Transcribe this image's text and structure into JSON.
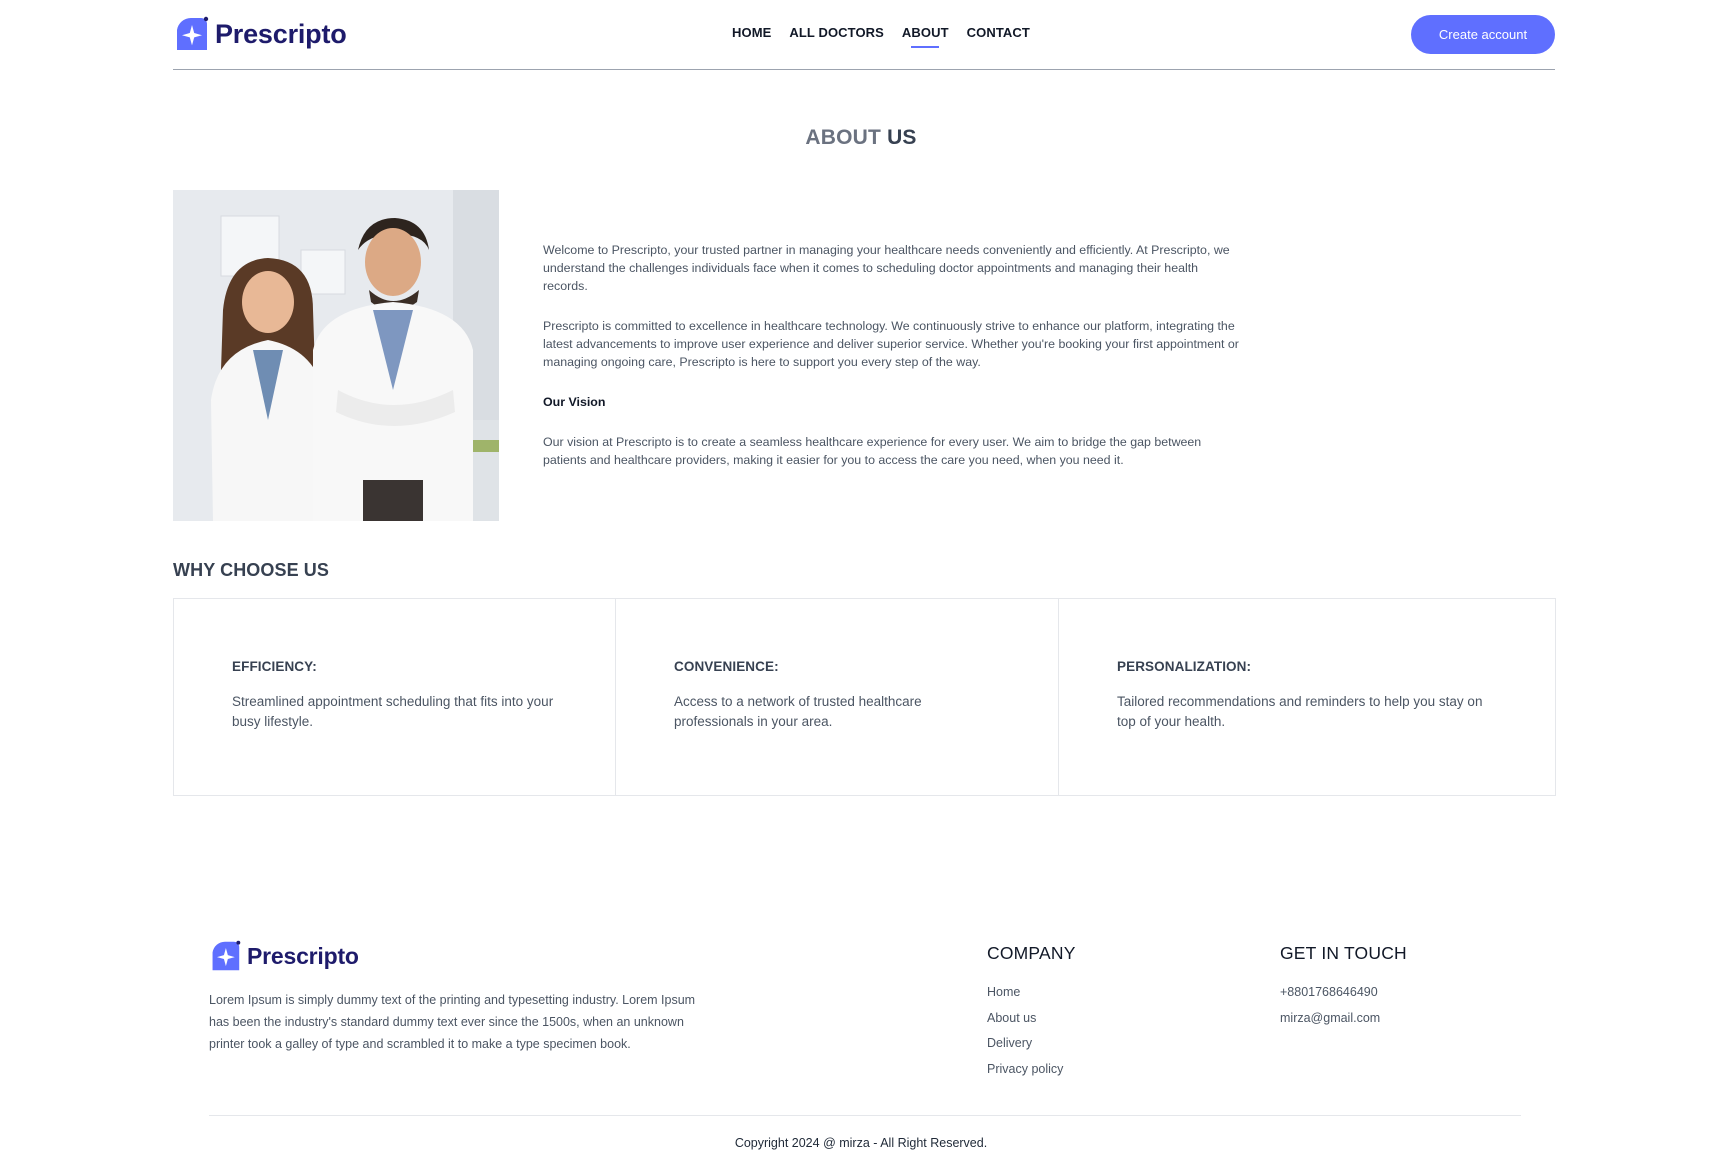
{
  "brand": {
    "name": "Prescripto",
    "accent_color": "#5f6fff",
    "brand_text_color": "#1e1b6b",
    "logo_icon": "star-cross-icon"
  },
  "nav": {
    "items": [
      {
        "label": "HOME",
        "active": false
      },
      {
        "label": "ALL DOCTORS",
        "active": false
      },
      {
        "label": "ABOUT",
        "active": true
      },
      {
        "label": "CONTACT",
        "active": false
      }
    ],
    "cta_label": "Create account"
  },
  "about": {
    "title_light": "ABOUT",
    "title_bold": "US",
    "paragraph_1": "Welcome to Prescripto, your trusted partner in managing your healthcare needs conveniently and efficiently. At Prescripto, we understand the challenges individuals face when it comes to scheduling doctor appointments and managing their health records.",
    "paragraph_2": "Prescripto is committed to excellence in healthcare technology. We continuously strive to enhance our platform, integrating the latest advancements to improve user experience and deliver superior service. Whether you're booking your first appointment or managing ongoing care, Prescripto is here to support you every step of the way.",
    "vision_title": "Our Vision",
    "vision_text": "Our vision at Prescripto is to create a seamless healthcare experience for every user. We aim to bridge the gap between patients and healthcare providers, making it easier for you to access the care you need, when you need it."
  },
  "why": {
    "title_light": "WHY",
    "title_bold": "CHOOSE US",
    "cards": [
      {
        "title": "EFFICIENCY:",
        "text": "Streamlined appointment scheduling that fits into your busy lifestyle."
      },
      {
        "title": "CONVENIENCE:",
        "text": "Access to a network of trusted healthcare professionals in your area."
      },
      {
        "title": "PERSONALIZATION:",
        "text": "Tailored recommendations and reminders to help you stay on top of your health."
      }
    ]
  },
  "footer": {
    "brand_name": "Prescripto",
    "description": "Lorem Ipsum is simply dummy text of the printing and typesetting industry. Lorem Ipsum has been the industry's standard dummy text ever since the 1500s, when an unknown printer took a galley of type and scrambled it to make a type specimen book.",
    "company": {
      "title": "COMPANY",
      "links": [
        "Home",
        "About us",
        "Delivery",
        "Privacy policy"
      ]
    },
    "contact": {
      "title": "GET IN TOUCH",
      "phone": "+8801768646490",
      "email": "mirza@gmail.com"
    },
    "copyright": "Copyright 2024 @ mirza - All Right Reserved."
  }
}
